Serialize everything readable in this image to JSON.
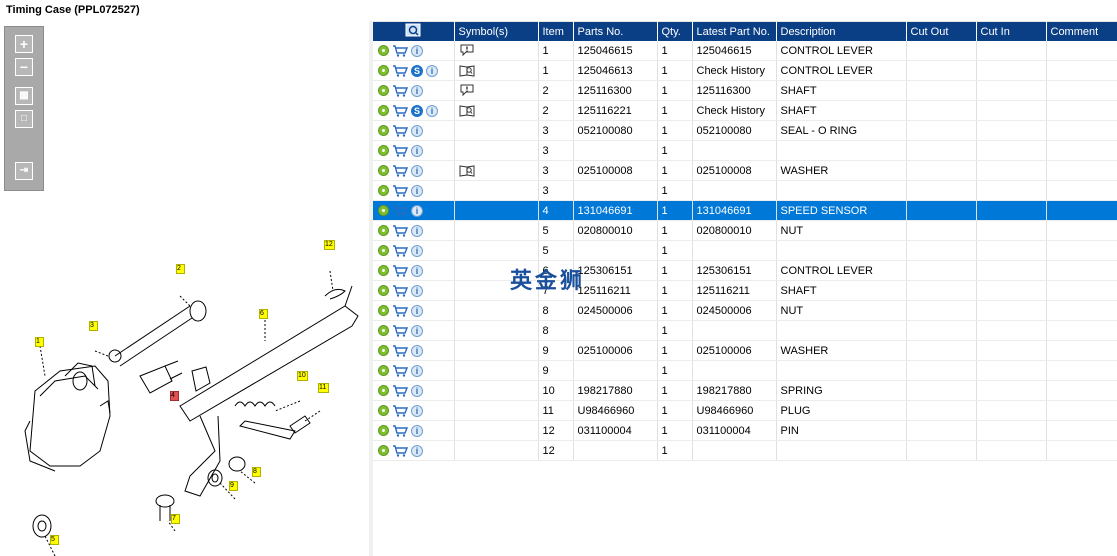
{
  "window": {
    "title": "Timing Case (PPL072527)"
  },
  "toolbar": {
    "tools": [
      {
        "name": "zoom-in-icon"
      },
      {
        "name": "zoom-out-icon"
      },
      {
        "name": "fit-all-icon"
      },
      {
        "name": "actual-size-icon"
      },
      {
        "name": "pane-toggle-icon"
      }
    ]
  },
  "diagram": {
    "callouts": [
      "1",
      "2",
      "3",
      "4",
      "5",
      "6",
      "7",
      "8",
      "9",
      "10",
      "11",
      "12"
    ]
  },
  "grid": {
    "columns": [
      "",
      "Symbol(s)",
      "Item",
      "Parts No.",
      "Qty.",
      "Latest Part No.",
      "Description",
      "Cut Out",
      "Cut In",
      "Comment"
    ],
    "rows": [
      {
        "item": "1",
        "part": "125046615",
        "qty": "1",
        "latest": "125046615",
        "desc": "CONTROL LEVER",
        "s": false,
        "sym": "comment-icon",
        "sel": false
      },
      {
        "item": "1",
        "part": "125046613",
        "qty": "1",
        "latest": "Check History",
        "desc": "CONTROL LEVER",
        "s": true,
        "sym": "history-icon",
        "sel": false
      },
      {
        "item": "2",
        "part": "125116300",
        "qty": "1",
        "latest": "125116300",
        "desc": "SHAFT",
        "s": false,
        "sym": "comment-icon",
        "sel": false
      },
      {
        "item": "2",
        "part": "125116221",
        "qty": "1",
        "latest": "Check History",
        "desc": "SHAFT",
        "s": true,
        "sym": "history-icon",
        "sel": false
      },
      {
        "item": "3",
        "part": "052100080",
        "qty": "1",
        "latest": "052100080",
        "desc": "SEAL - O RING",
        "s": false,
        "sym": "",
        "sel": false
      },
      {
        "item": "3",
        "part": "",
        "qty": "1",
        "latest": "",
        "desc": "",
        "s": false,
        "sym": "",
        "sel": false
      },
      {
        "item": "3",
        "part": "025100008",
        "qty": "1",
        "latest": "025100008",
        "desc": "WASHER",
        "s": false,
        "sym": "history-icon",
        "sel": false
      },
      {
        "item": "3",
        "part": "",
        "qty": "1",
        "latest": "",
        "desc": "",
        "s": false,
        "sym": "",
        "sel": false
      },
      {
        "item": "4",
        "part": "131046691",
        "qty": "1",
        "latest": "131046691",
        "desc": "SPEED SENSOR",
        "s": false,
        "sym": "",
        "sel": true
      },
      {
        "item": "5",
        "part": "020800010",
        "qty": "1",
        "latest": "020800010",
        "desc": "NUT",
        "s": false,
        "sym": "",
        "sel": false
      },
      {
        "item": "5",
        "part": "",
        "qty": "1",
        "latest": "",
        "desc": "",
        "s": false,
        "sym": "",
        "sel": false
      },
      {
        "item": "6",
        "part": "125306151",
        "qty": "1",
        "latest": "125306151",
        "desc": "CONTROL LEVER",
        "s": false,
        "sym": "",
        "sel": false
      },
      {
        "item": "7",
        "part": "125116211",
        "qty": "1",
        "latest": "125116211",
        "desc": "SHAFT",
        "s": false,
        "sym": "",
        "sel": false
      },
      {
        "item": "8",
        "part": "024500006",
        "qty": "1",
        "latest": "024500006",
        "desc": "NUT",
        "s": false,
        "sym": "",
        "sel": false
      },
      {
        "item": "8",
        "part": "",
        "qty": "1",
        "latest": "",
        "desc": "",
        "s": false,
        "sym": "",
        "sel": false
      },
      {
        "item": "9",
        "part": "025100006",
        "qty": "1",
        "latest": "025100006",
        "desc": "WASHER",
        "s": false,
        "sym": "",
        "sel": false
      },
      {
        "item": "9",
        "part": "",
        "qty": "1",
        "latest": "",
        "desc": "",
        "s": false,
        "sym": "",
        "sel": false
      },
      {
        "item": "10",
        "part": "198217880",
        "qty": "1",
        "latest": "198217880",
        "desc": "SPRING",
        "s": false,
        "sym": "",
        "sel": false
      },
      {
        "item": "11",
        "part": "U98466960",
        "qty": "1",
        "latest": "U98466960",
        "desc": "PLUG",
        "s": false,
        "sym": "",
        "sel": false
      },
      {
        "item": "12",
        "part": "031100004",
        "qty": "1",
        "latest": "031100004",
        "desc": "PIN",
        "s": false,
        "sym": "",
        "sel": false
      },
      {
        "item": "12",
        "part": "",
        "qty": "1",
        "latest": "",
        "desc": "",
        "s": false,
        "sym": "",
        "sel": false
      }
    ]
  },
  "watermark": {
    "text": "英金狮"
  },
  "colors": {
    "header": "#0a3f86",
    "selected": "#0078d7",
    "callout_bg": "#ffff00",
    "callout_selected": "#e05050"
  }
}
